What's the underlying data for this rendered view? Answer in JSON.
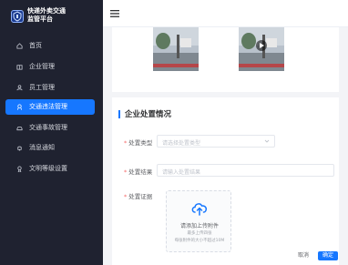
{
  "app": {
    "title_line1": "快递外卖交通",
    "title_line2": "监管平台",
    "logo_icon": "shield-logo-icon"
  },
  "sidebar": {
    "items": [
      {
        "label": "首页",
        "icon": "home-icon",
        "active": false
      },
      {
        "label": "企业管理",
        "icon": "building-icon",
        "active": false
      },
      {
        "label": "员工管理",
        "icon": "staff-icon",
        "active": false
      },
      {
        "label": "交通违法管理",
        "icon": "violation-icon",
        "active": true
      },
      {
        "label": "交通事故管理",
        "icon": "car-icon",
        "active": false
      },
      {
        "label": "消息通知",
        "icon": "bell-icon",
        "active": false
      },
      {
        "label": "文明等级设置",
        "icon": "badge-icon",
        "active": false
      }
    ]
  },
  "topbar": {
    "menu_icon": "hamburger-icon"
  },
  "section": {
    "title": "企业处置情况"
  },
  "form": {
    "type_label": "处置类型",
    "type_placeholder": "请选择处置类型",
    "result_label": "处置结果",
    "result_placeholder": "请输入处置结果",
    "evidence_label": "处置证据"
  },
  "upload": {
    "icon": "cloud-upload-icon",
    "text": "请添加上传附件",
    "hint_line1": "最多上传四张",
    "hint_line2": "每张附件的大小不超过10M"
  },
  "actions": {
    "cancel": "取消",
    "confirm": "确定"
  },
  "colors": {
    "sidebar_bg": "#1f2230",
    "accent": "#1677ff",
    "required": "#f56c6c"
  }
}
